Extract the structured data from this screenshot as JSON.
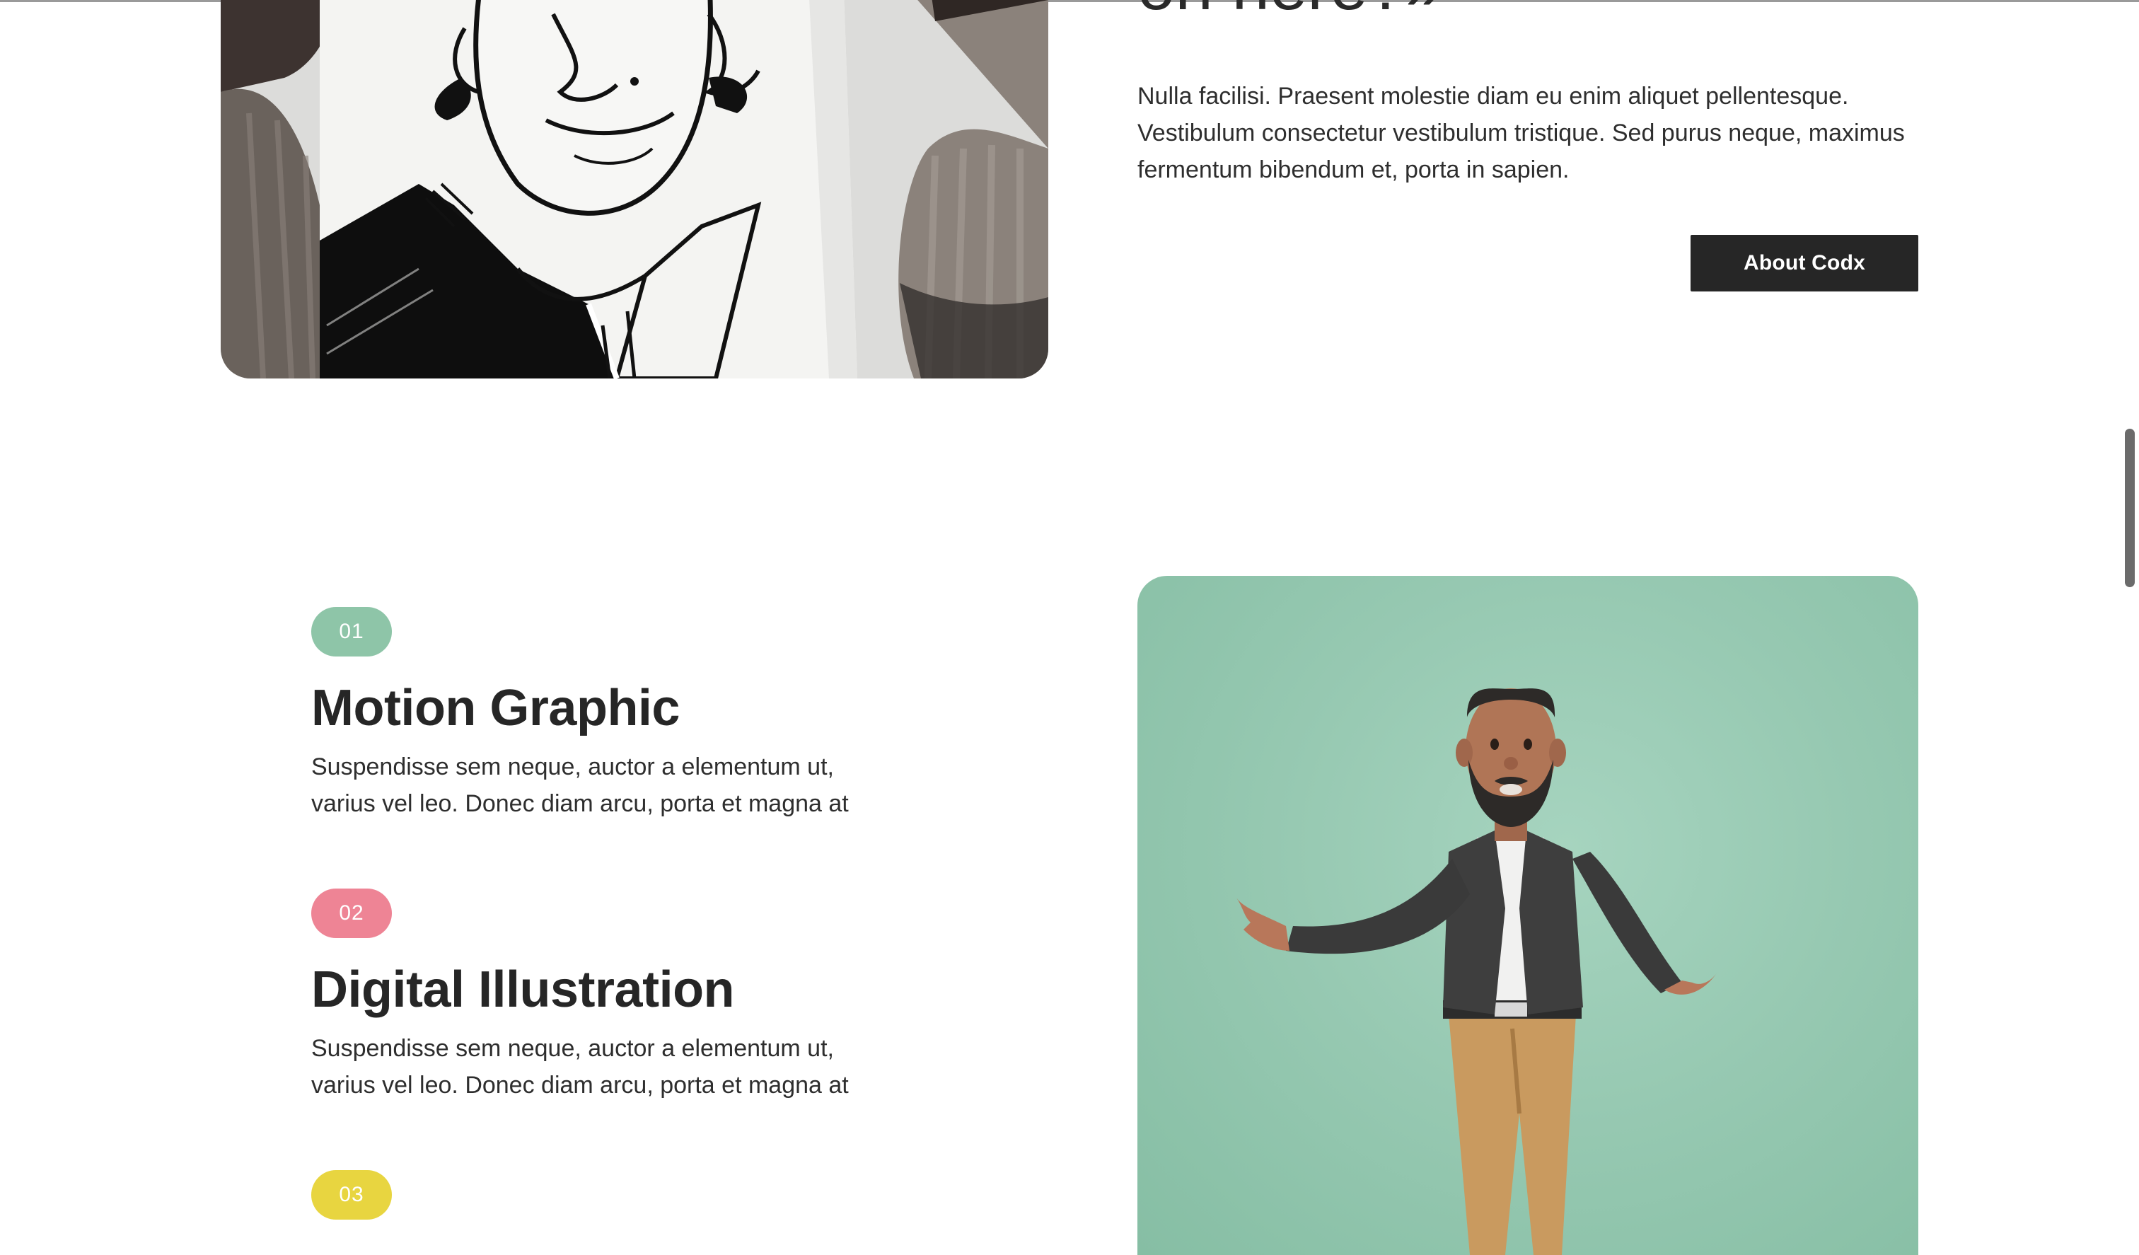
{
  "heading_partial": "on here?»",
  "about": {
    "text": "Nulla facilisi. Praesent molestie diam eu enim aliquet pellentesque. Vestibulum consectetur vestibulum tristique. Sed purus neque, maximus fermentum bibendum et, porta in sapien.",
    "button_label": "About Codx"
  },
  "services": [
    {
      "number": "01",
      "badge_color": "#8ec5a8",
      "title": "Motion Graphic",
      "description": "Suspendisse sem neque, auctor a elementum ut, varius vel leo. Donec diam arcu, porta et magna at"
    },
    {
      "number": "02",
      "badge_color": "#ee8495",
      "title": "Digital Illustration",
      "description": "Suspendisse sem neque, auctor a elementum ut, varius vel leo. Donec diam arcu, porta et magna at"
    },
    {
      "number": "03",
      "badge_color": "#e8d540"
    }
  ],
  "colors": {
    "text": "#2a2a2a",
    "button_bg": "#262626",
    "figure_bg": "#97c9b2"
  }
}
